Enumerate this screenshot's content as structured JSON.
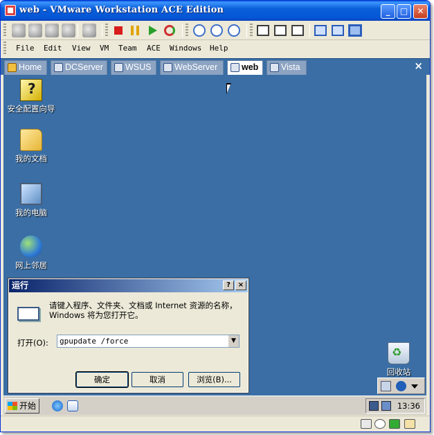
{
  "window": {
    "title": "web - VMware Workstation ACE Edition",
    "minimize_glyph": "_",
    "maximize_glyph": "□",
    "close_glyph": "✕"
  },
  "menu": [
    "File",
    "Edit",
    "View",
    "VM",
    "Team",
    "ACE",
    "Windows",
    "Help"
  ],
  "tabs": [
    "Home",
    "DCServer",
    "WSUS",
    "WebServer",
    "web",
    "Vista"
  ],
  "active_tab": "web",
  "tab_close": "×",
  "desktop": {
    "icons": [
      "安全配置向导",
      "我的文档",
      "我的电脑",
      "网上邻居",
      "回收站"
    ]
  },
  "run_dialog": {
    "title": "运行",
    "help_glyph": "?",
    "close_glyph": "×",
    "description": "请键入程序、文件夹、文档或 Internet 资源的名称，Windows 将为您打开它。",
    "open_label": "打开(O):",
    "open_value": "gpupdate /force",
    "ok_label": "确定",
    "cancel_label": "取消",
    "browse_label": "浏览(B)..."
  },
  "taskbar": {
    "start_label": "开始",
    "clock": "13:36"
  },
  "colors": {
    "desktop": "#3a6ea5",
    "title_bar": "#0a5fd8",
    "dialog_title": "#0a246a"
  }
}
